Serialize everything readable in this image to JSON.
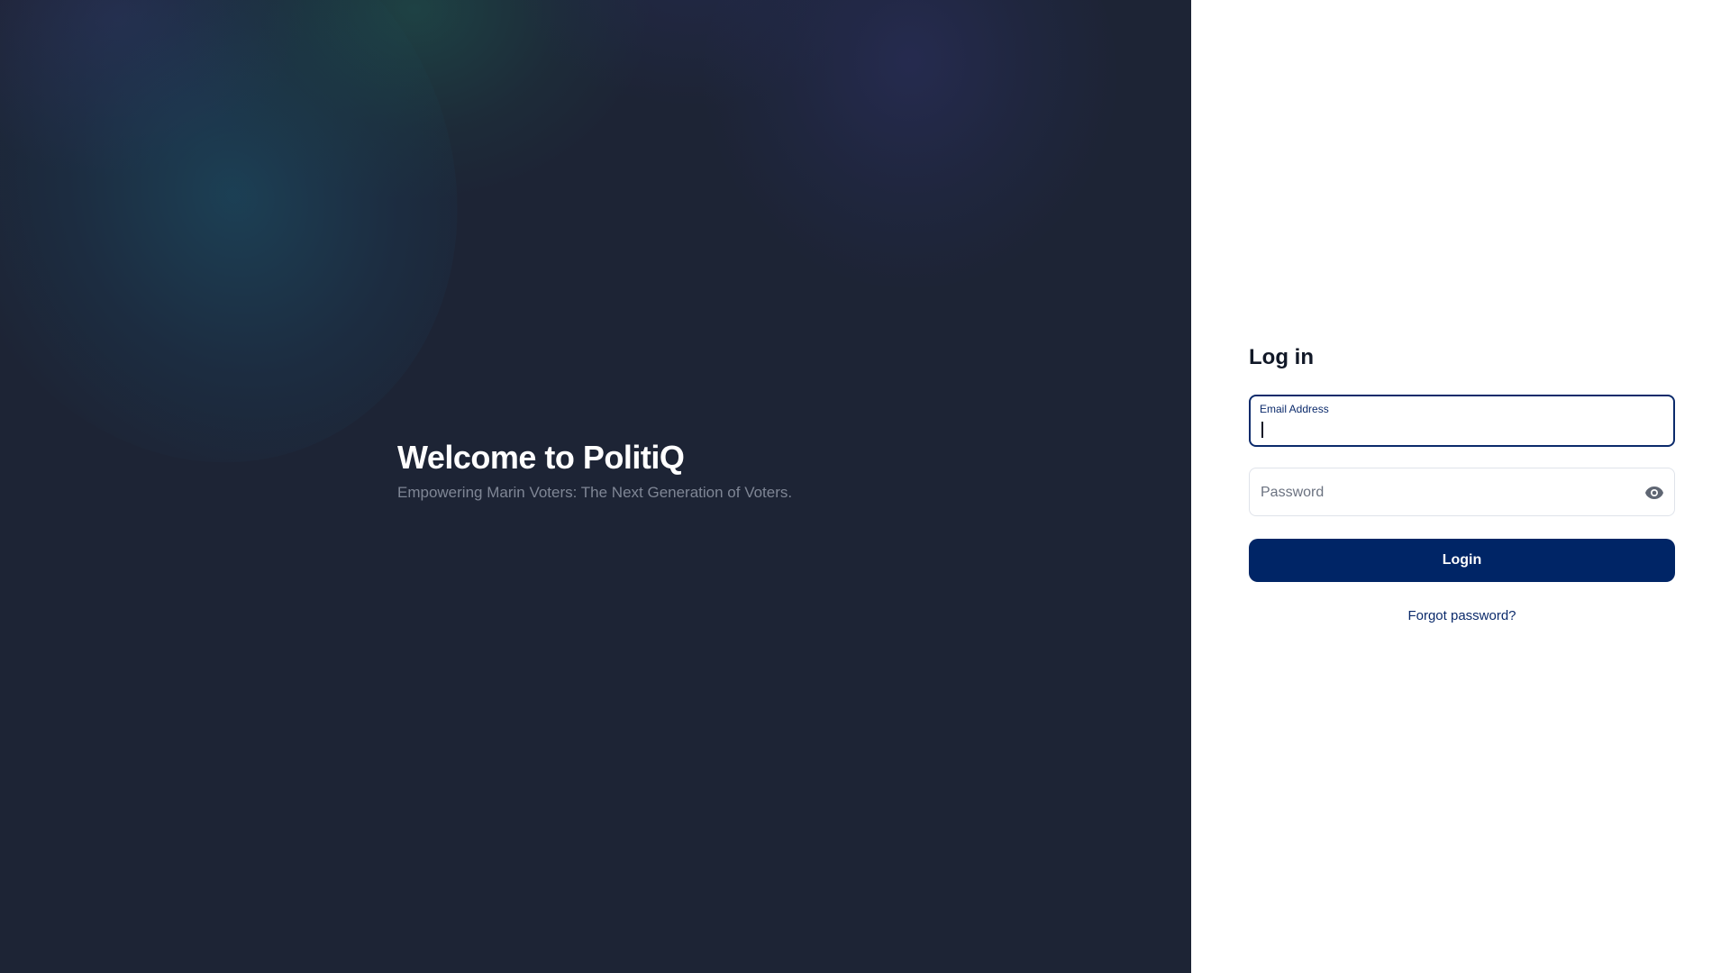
{
  "hero": {
    "title": "Welcome to PolitiQ",
    "subtitle": "Empowering Marin Voters: The Next Generation of Voters."
  },
  "login": {
    "title": "Log in",
    "email": {
      "label": "Email Address",
      "value": ""
    },
    "password": {
      "placeholder": "Password",
      "value": "",
      "toggle_icon": "eye-icon"
    },
    "submit_label": "Login",
    "forgot_label": "Forgot password?"
  },
  "colors": {
    "hero_background": "#1d2435",
    "primary": "#002566",
    "focus_border": "#0b2a6b",
    "panel_background": "#ffffff"
  }
}
